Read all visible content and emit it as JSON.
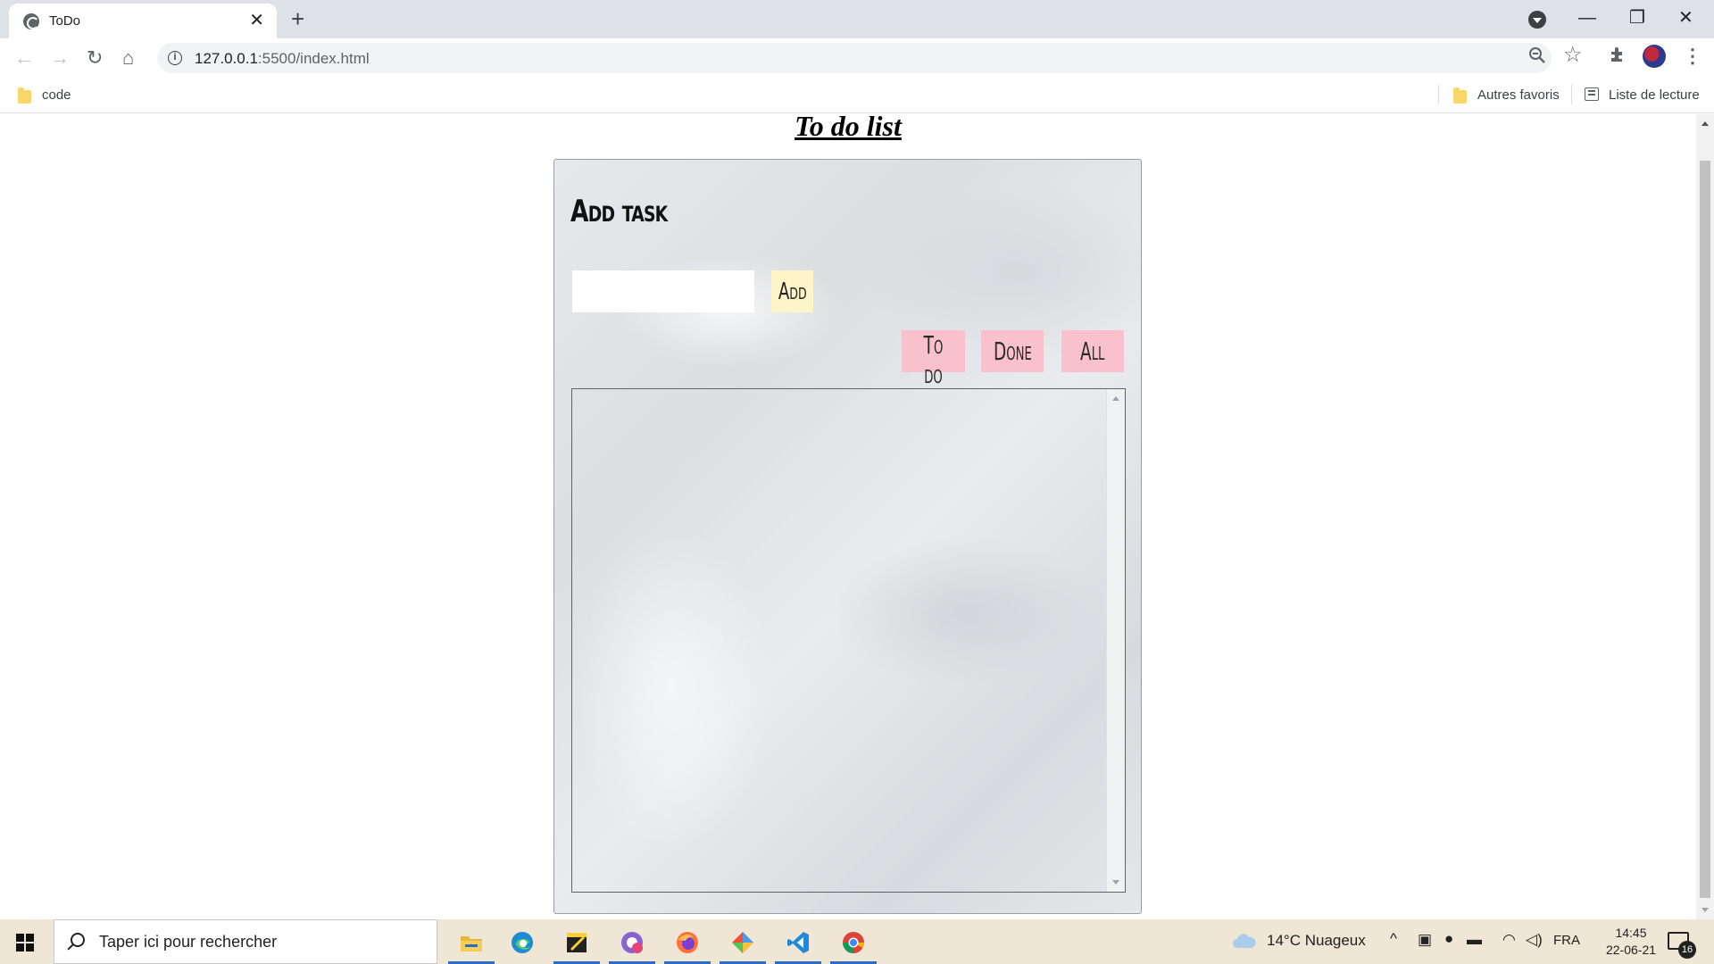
{
  "browser": {
    "tab_title": "ToDo",
    "tab_close": "✕",
    "new_tab": "+",
    "window_controls": {
      "minimize": "—",
      "restore": "❐",
      "close": "✕"
    },
    "nav": {
      "back": "←",
      "forward": "→",
      "reload": "↻",
      "home": "⌂"
    },
    "url_host": "127.0.0.1",
    "url_path": ":5500/index.html",
    "star": "☆",
    "menu": "⋮",
    "bookmarks": {
      "left": [
        {
          "label": "code",
          "icon": "folder-icon"
        }
      ],
      "right": [
        {
          "label": "Autres favoris",
          "icon": "folder-icon"
        },
        {
          "label": "Liste de lecture",
          "icon": "reading-list-icon"
        }
      ]
    }
  },
  "page": {
    "title": "To do list",
    "add_heading": "Add task",
    "input_value": "",
    "add_button": "Add",
    "filters": [
      {
        "label": "To do"
      },
      {
        "label": "Done"
      },
      {
        "label": "All"
      }
    ],
    "colors": {
      "add_button_bg": "#fdf5c7",
      "filter_button_bg": "#f8c1cc"
    }
  },
  "taskbar": {
    "search_placeholder": "Taper ici pour rechercher",
    "apps": [
      "file-explorer-icon",
      "edge-icon",
      "sticky-notes-icon",
      "messenger-icon",
      "firefox-icon",
      "git-icon",
      "vscode-icon",
      "chrome-icon"
    ],
    "weather": "14°C  Nuageux",
    "language": "FRA",
    "time": "14:45",
    "date": "22-06-21",
    "notifications": "16"
  }
}
